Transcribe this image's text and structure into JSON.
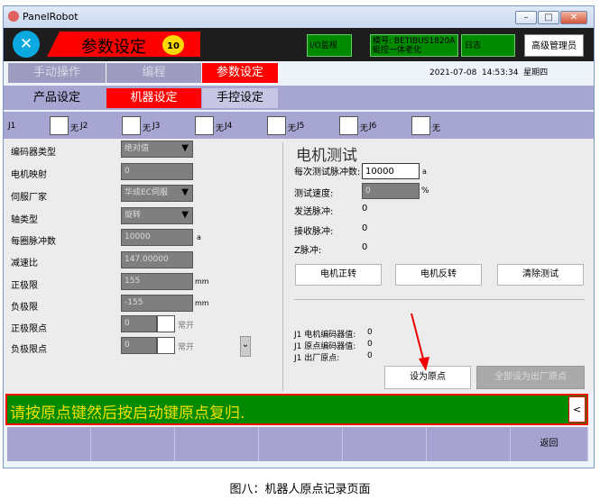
{
  "window": {
    "title": "PanelRobot",
    "min": "–",
    "max": "□",
    "close": "✕"
  },
  "header": {
    "page_title": "参数设定",
    "level": "10",
    "io_label": "I/O监视",
    "mold_label": "模号: BETIBUS1820A蜓控一体老化",
    "log_label": "日志",
    "user_button": "高级管理员",
    "datetime": "2021-07-08  14:53:34  星期四"
  },
  "main_tabs": [
    "手动操作",
    "编程",
    "参数设定"
  ],
  "sub_tabs": [
    "产品设定",
    "机器设定",
    "手控设定"
  ],
  "joints": [
    {
      "label": "J1",
      "state": "无"
    },
    {
      "label": "J2",
      "state": "无"
    },
    {
      "label": "J3",
      "state": "无"
    },
    {
      "label": "J4",
      "state": "无"
    },
    {
      "label": "J5",
      "state": "无"
    },
    {
      "label": "J6",
      "state": "无"
    }
  ],
  "params": {
    "encoder_type": {
      "label": "编码器类型",
      "value": "绝对值"
    },
    "motor_map": {
      "label": "电机映射",
      "value": "0"
    },
    "servo_vendor": {
      "label": "伺服厂家",
      "value": "华成EC伺服"
    },
    "axis_type": {
      "label": "轴类型",
      "value": "旋转"
    },
    "pulses_per_rev": {
      "label": "每圈脉冲数",
      "value": "10000",
      "unit": "a"
    },
    "reduction": {
      "label": "减速比",
      "value": "147.00000"
    },
    "pos_limit": {
      "label": "正极限",
      "value": "155",
      "unit": "mm"
    },
    "neg_limit": {
      "label": "负极限",
      "value": "-155",
      "unit": "mm"
    },
    "pos_limit_point": {
      "label": "正极限点",
      "value": "0",
      "state": "常开"
    },
    "neg_limit_point": {
      "label": "负极限点",
      "value": "0",
      "state": "常开"
    },
    "down_arrow": "⌄"
  },
  "motor_test": {
    "title": "电机测试",
    "pulses_label": "每次测试脉冲数:",
    "pulses_value": "10000",
    "pulses_unit": "a",
    "speed_label": "测试速度:",
    "speed_value": "0",
    "speed_unit": "%",
    "send_label": "发送脉冲:",
    "send_value": "0",
    "recv_label": "接收脉冲:",
    "recv_value": "0",
    "z_label": "Z脉冲:",
    "z_value": "0",
    "fwd_button": "电机正转",
    "rev_button": "电机反转",
    "clear_button": "清除测试"
  },
  "encoder_info": {
    "motor_enc_label": "J1 电机编码器值:",
    "motor_enc_value": "0",
    "origin_enc_label": "J1 原点编码器值:",
    "origin_enc_value": "0",
    "factory_label": "J1 出厂原点:",
    "factory_value": "0"
  },
  "actions": {
    "set_origin": "设为原点",
    "set_all_factory": "全部设为出厂原点"
  },
  "message": {
    "text": "请按原点键然后按启动键原点复归.",
    "back_arrow": "<"
  },
  "footer": {
    "return_label": "返回"
  },
  "caption": "图八：机器人原点记录页面",
  "colors": {
    "accent_red": "#ff0000",
    "message_green": "#008a00",
    "message_text": "#f0e000",
    "tab_purple": "#a7a6d2"
  }
}
